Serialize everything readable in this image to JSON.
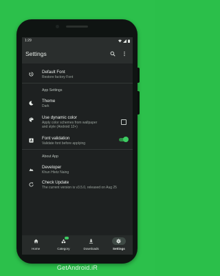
{
  "status_bar": {
    "time": "1:29"
  },
  "app_bar": {
    "title": "Settings"
  },
  "settings": {
    "default_font": {
      "title": "Default Font",
      "subtitle": "Restore factory Font"
    },
    "section_app_settings": "App Settings",
    "theme": {
      "title": "Theme",
      "subtitle": "Dark"
    },
    "dynamic_color": {
      "title": "Use dynamic color",
      "subtitle_line1": "Apply color schemes from wallpaper",
      "subtitle_line2": "and style (Android 12+)",
      "checked": false
    },
    "font_validation": {
      "title": "Font validation",
      "subtitle": "Validate font before applying",
      "enabled": true
    },
    "section_about_app": "About App",
    "developer": {
      "title": "Developer",
      "subtitle": "Khun Htetz Naing"
    },
    "check_update": {
      "title": "Check Update",
      "subtitle": "The current version is v3.5.0, released on Aug 25"
    }
  },
  "nav": {
    "home": "Home",
    "category": "Category",
    "downloads": "Downloads",
    "settings": "Settings",
    "active": "settings"
  },
  "watermark": "GetAndroid.iR",
  "colors": {
    "background": "#2cc04b",
    "accent": "#3dcc62",
    "surface": "#1e2121"
  }
}
